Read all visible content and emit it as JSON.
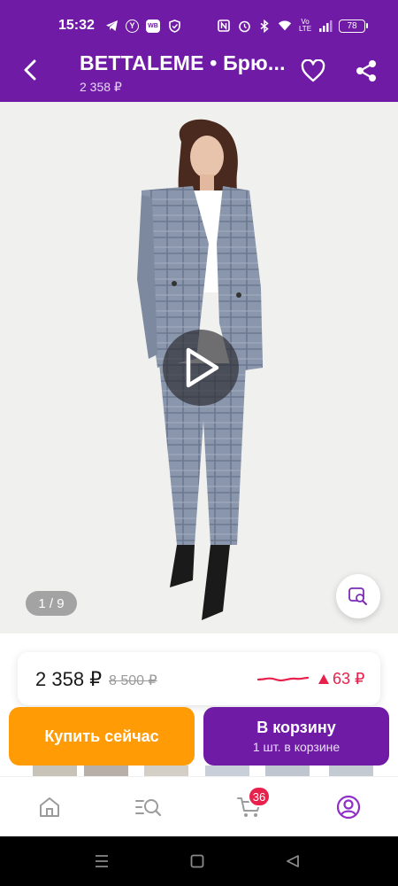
{
  "status_bar": {
    "time": "15:32",
    "battery": "78",
    "icons": [
      "telegram-icon",
      "yandex-icon",
      "wb-icon",
      "shield-icon",
      "nfc-icon",
      "alarm-icon",
      "bluetooth-icon",
      "wifi-icon",
      "volte-icon",
      "signal-icon",
      "battery-icon"
    ]
  },
  "header": {
    "title": "BETTALEME • Брю...",
    "price": "2 358 ₽",
    "back_icon": "back-arrow-icon",
    "favorite_icon": "heart-icon",
    "share_icon": "share-icon"
  },
  "gallery": {
    "counter": "1 / 9",
    "play_icon": "play-icon",
    "visual_search_icon": "visual-search-icon"
  },
  "price_card": {
    "current_price": "2 358 ₽",
    "old_price": "8 500 ₽",
    "price_change": "63 ₽",
    "trend_color": "#e8204c"
  },
  "actions": {
    "buy_now": "Купить сейчас",
    "add_to_cart": "В корзину",
    "cart_status": "1 шт. в корзине"
  },
  "bottom_nav": {
    "items": [
      {
        "name": "home",
        "icon": "home-icon"
      },
      {
        "name": "catalog",
        "icon": "catalog-search-icon"
      },
      {
        "name": "cart",
        "icon": "cart-icon"
      },
      {
        "name": "profile",
        "icon": "profile-icon"
      }
    ],
    "cart_badge": "36"
  },
  "colors": {
    "brand": "#6f1ba6",
    "buy_now": "#ff9b05",
    "badge": "#e8204c"
  }
}
